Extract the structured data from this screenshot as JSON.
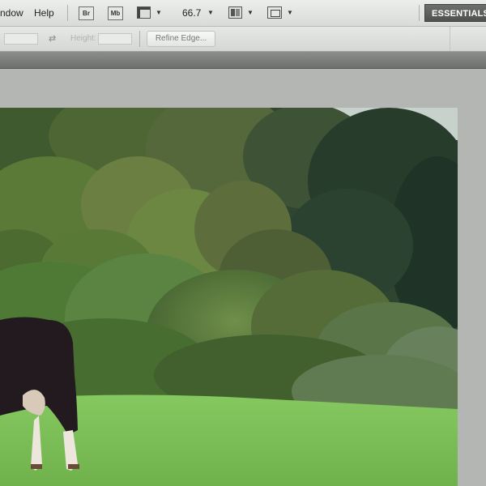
{
  "menubar": {
    "items": [
      "ndow",
      "Help"
    ],
    "bridge_label": "Br",
    "minibridge_label": "Mb",
    "zoom_value": "66.7",
    "workspace_label": "ESSENTIALS"
  },
  "options": {
    "refine_edge_label": "Refine Edge...",
    "height_label": "Height:"
  },
  "colors": {
    "sky": "#c8d2cc",
    "grass": "#7fc25a",
    "cow_body": "#231a20"
  },
  "photo": {
    "subject": "cow-in-field"
  }
}
